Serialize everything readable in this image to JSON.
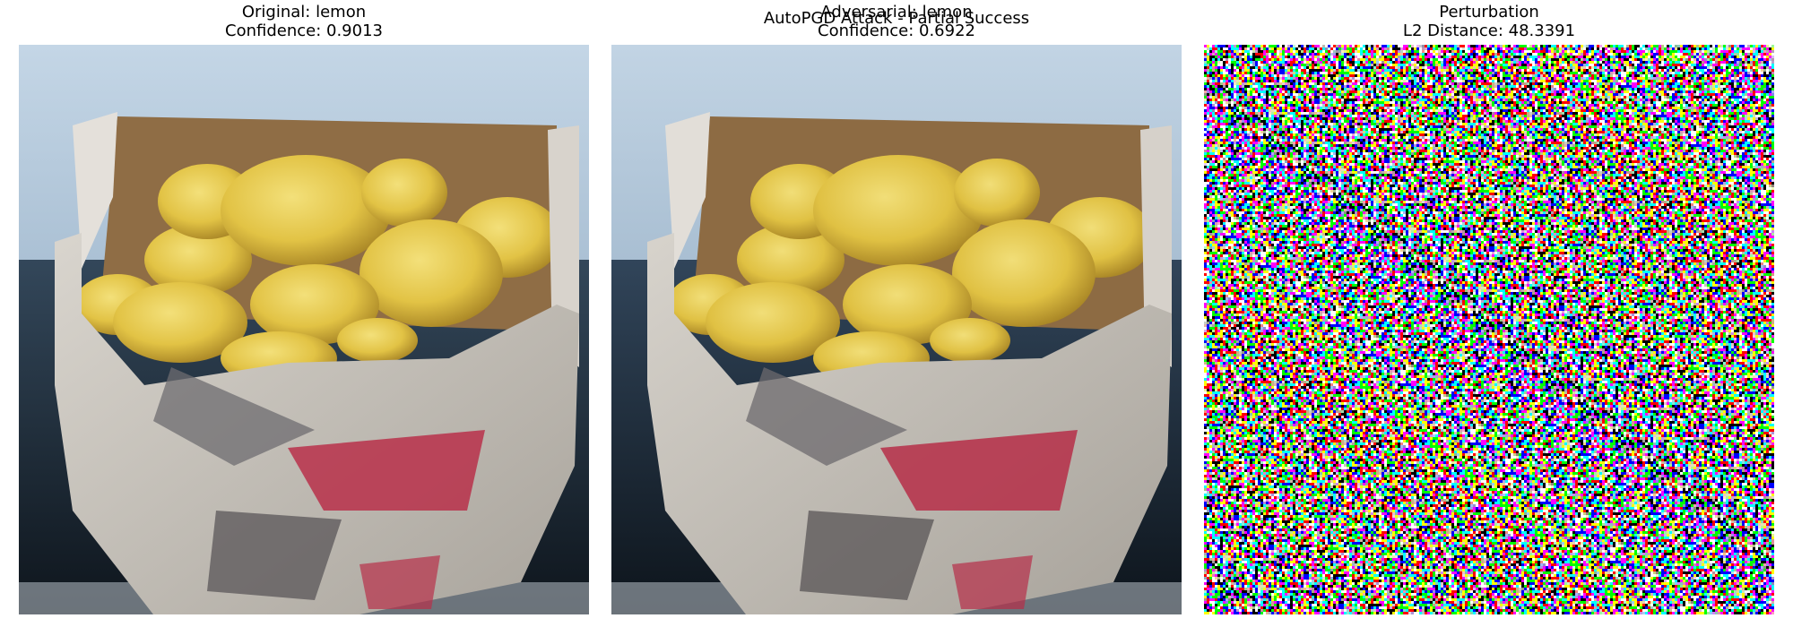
{
  "figure": {
    "suptitle": "AutoPGD Attack - Partial Success"
  },
  "panels": [
    {
      "id": "original",
      "title_line1": "Original: lemon",
      "title_line2": "Confidence: 0.9013",
      "image_icon": "photo-lemons-in-paper-bag"
    },
    {
      "id": "adversarial",
      "title_line1": "Adversarial: lemon",
      "title_line2": "Confidence: 0.6922",
      "image_icon": "photo-lemons-in-paper-bag"
    },
    {
      "id": "perturbation",
      "title_line1": "Perturbation",
      "title_line2": "L2 Distance: 48.3391",
      "image_icon": "random-color-noise"
    }
  ],
  "colors": {
    "sky": "#b9cde0",
    "bag": "#c8c3bb",
    "bag_inner": "#9a7a52",
    "lemon": "#e6c94a",
    "lemon_shadow": "#b8952a",
    "print_red": "#b8304a",
    "ground": "#1e2a36"
  }
}
